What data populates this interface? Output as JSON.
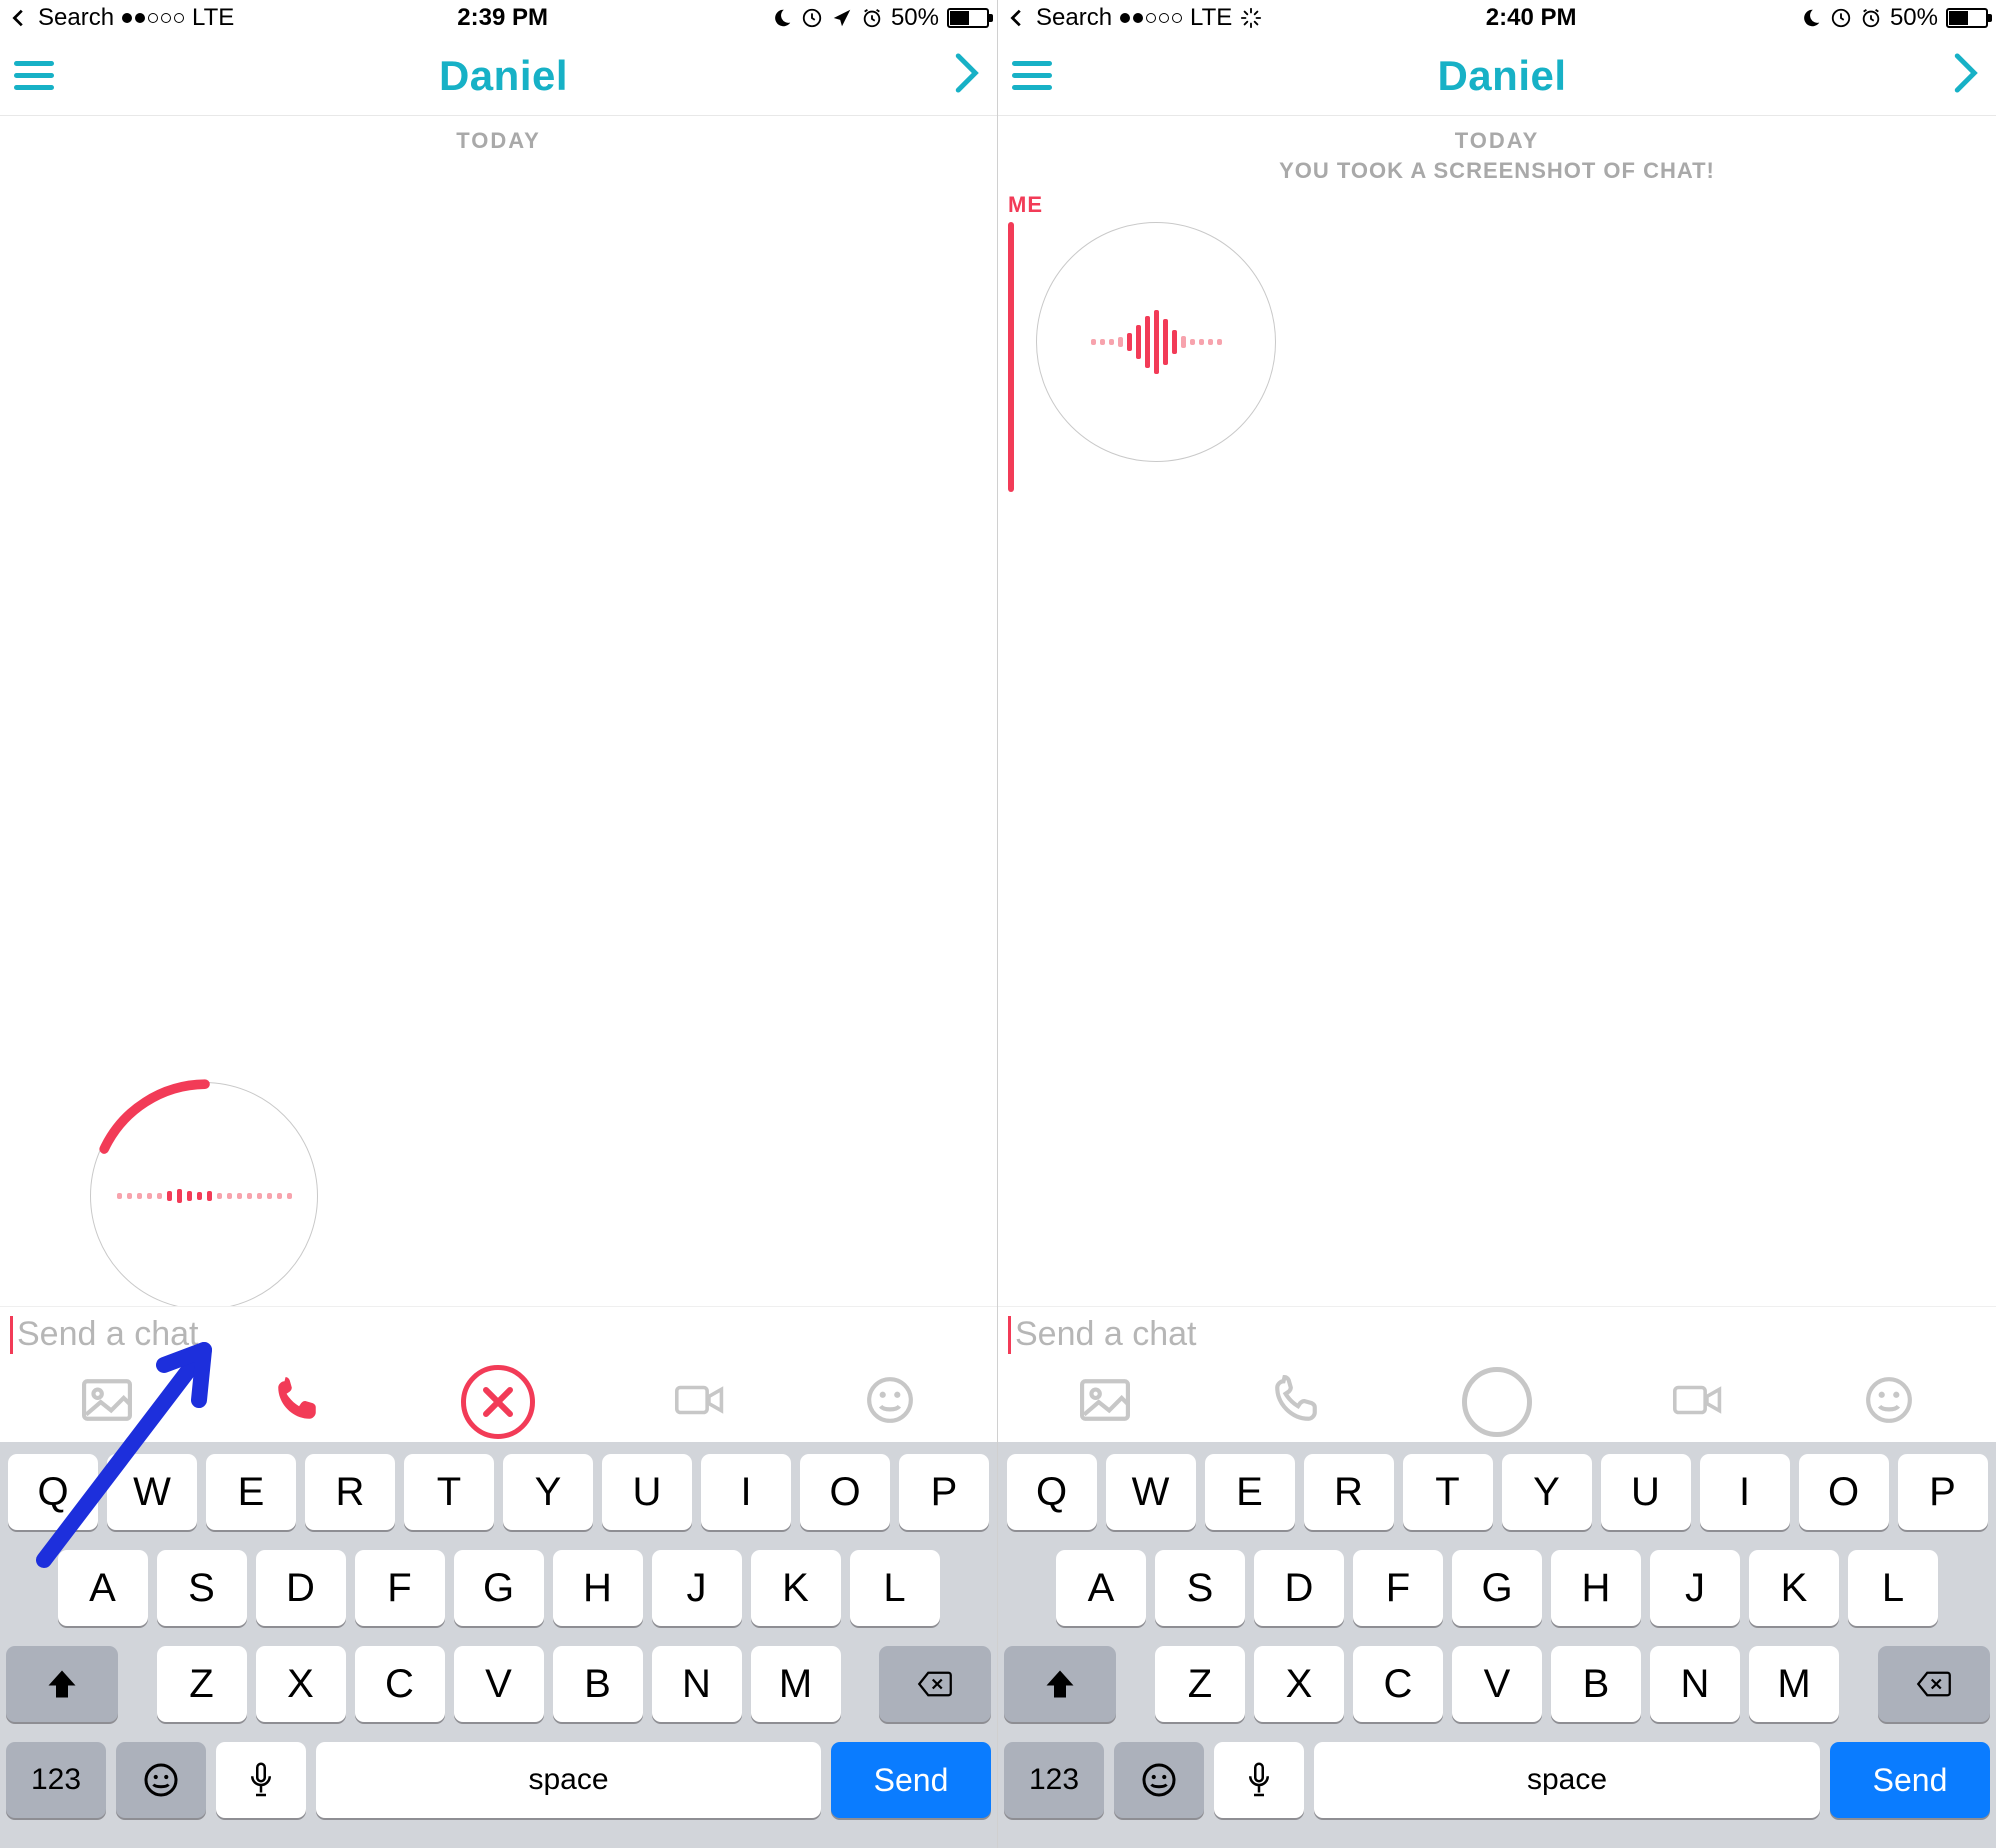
{
  "left": {
    "status": {
      "back": "Search",
      "carrier": "LTE",
      "time": "2:39 PM",
      "battery": "50%"
    },
    "nav": {
      "title": "Daniel"
    },
    "chat": {
      "today": "TODAY"
    },
    "input": {
      "placeholder": "Send a chat"
    }
  },
  "right": {
    "status": {
      "back": "Search",
      "carrier": "LTE",
      "time": "2:40 PM",
      "battery": "50%"
    },
    "nav": {
      "title": "Daniel"
    },
    "chat": {
      "today": "TODAY",
      "notice": "YOU TOOK A SCREENSHOT OF CHAT!",
      "me": "ME"
    },
    "input": {
      "placeholder": "Send a chat"
    }
  },
  "kbd": {
    "r1": [
      "Q",
      "W",
      "E",
      "R",
      "T",
      "Y",
      "U",
      "I",
      "O",
      "P"
    ],
    "r2": [
      "A",
      "S",
      "D",
      "F",
      "G",
      "H",
      "J",
      "K",
      "L"
    ],
    "r3": [
      "Z",
      "X",
      "C",
      "V",
      "B",
      "N",
      "M"
    ],
    "n123": "123",
    "space": "space",
    "send": "Send"
  }
}
